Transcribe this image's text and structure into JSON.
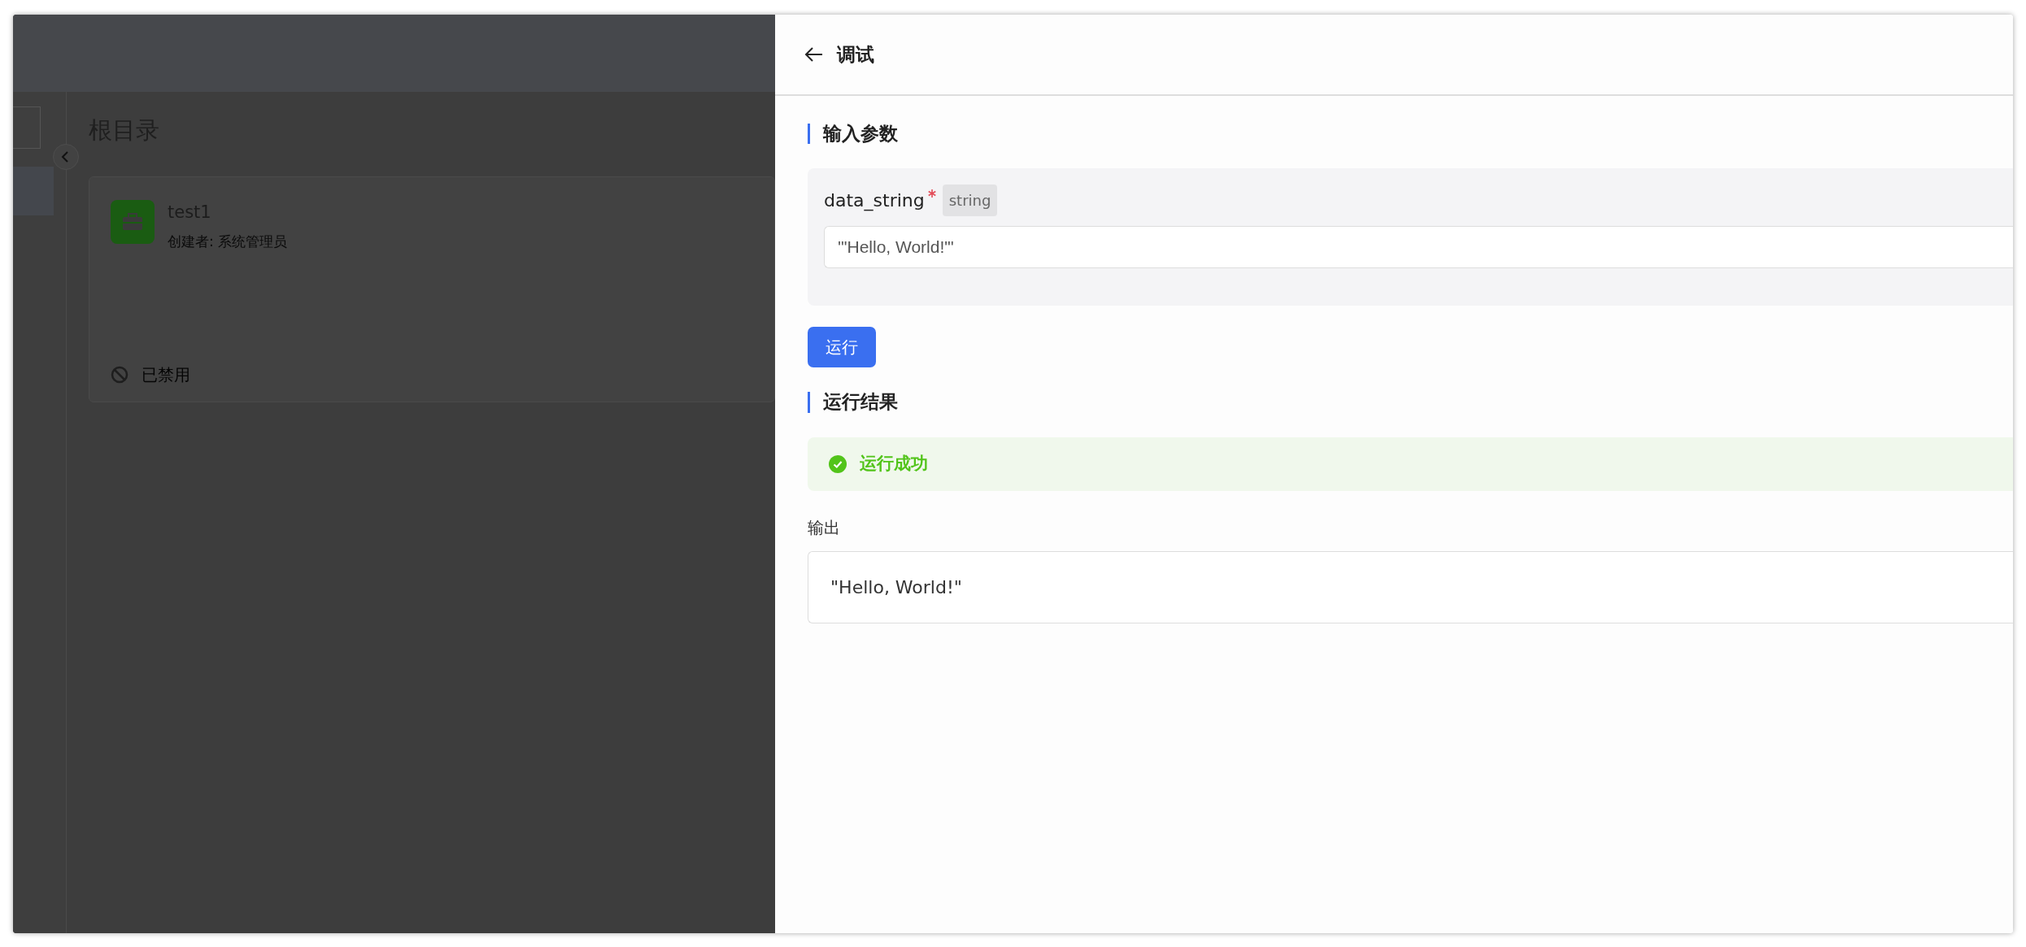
{
  "background": {
    "folder_title": "根目录",
    "card": {
      "name": "test1",
      "creator": "创建者: 系统管理员",
      "status": "已禁用",
      "disabled": true
    }
  },
  "drawer": {
    "title": "调试",
    "input_section": {
      "title": "输入参数",
      "params": [
        {
          "name": "data_string",
          "required": true,
          "type": "string",
          "value": "'\"Hello, World!\"'"
        }
      ]
    },
    "run_button": "运行",
    "result_section": {
      "title": "运行结果",
      "status": {
        "kind": "success",
        "text": "运行成功"
      },
      "output_label": "输出",
      "output": "\"Hello, World!\""
    }
  }
}
